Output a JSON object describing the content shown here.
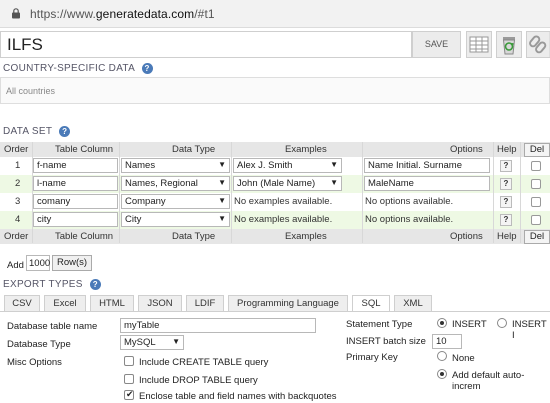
{
  "browser": {
    "url_prefix": "https://www.",
    "url_host": "generatedata.com",
    "url_suffix": "/#t1"
  },
  "header": {
    "title": "ILFS",
    "save_label": "SAVE"
  },
  "country": {
    "heading": "COUNTRY-SPECIFIC DATA",
    "value": "All countries"
  },
  "dataset": {
    "heading": "DATA SET",
    "columns": {
      "order": "Order",
      "table_column": "Table Column",
      "data_type": "Data Type",
      "examples": "Examples",
      "options": "Options",
      "help": "Help",
      "del": "Del"
    },
    "rows": [
      {
        "order": "1",
        "column": "f-name",
        "type": "Names",
        "example": "Alex J. Smith",
        "example_is_select": true,
        "option": "Name Initial. Surname",
        "option_is_input": true
      },
      {
        "order": "2",
        "column": "l-name",
        "type": "Names, Regional",
        "example": "John (Male Name)",
        "example_is_select": true,
        "option": "MaleName",
        "option_is_input": true
      },
      {
        "order": "3",
        "column": "comany",
        "type": "Company",
        "example": "No examples available.",
        "example_is_select": false,
        "option": "No options available.",
        "option_is_input": false
      },
      {
        "order": "4",
        "column": "city",
        "type": "City",
        "example": "No examples available.",
        "example_is_select": false,
        "option": "No options available.",
        "option_is_input": false
      }
    ],
    "help_glyph": "?",
    "add_label": "Add",
    "add_count": "1000",
    "add_button": "Row(s)"
  },
  "export": {
    "heading": "EXPORT TYPES",
    "tabs": [
      "CSV",
      "Excel",
      "HTML",
      "JSON",
      "LDIF",
      "Programming Language",
      "SQL",
      "XML"
    ],
    "active_tab": "SQL",
    "fields": {
      "table_name_label": "Database table name",
      "table_name_value": "myTable",
      "db_type_label": "Database Type",
      "db_type_value": "MySQL",
      "misc_label": "Misc Options",
      "misc_options": [
        {
          "label": "Include CREATE TABLE query",
          "checked": false
        },
        {
          "label": "Include DROP TABLE query",
          "checked": false
        },
        {
          "label": "Enclose table and field names with backquotes",
          "checked": true
        }
      ],
      "statement_type_label": "Statement Type",
      "statement_types": [
        {
          "label": "INSERT",
          "selected": true
        },
        {
          "label": "INSERT I",
          "selected": false
        }
      ],
      "batch_size_label": "INSERT batch size",
      "batch_size_value": "10",
      "primary_key_label": "Primary Key",
      "primary_key_options": [
        {
          "label": "None",
          "selected": false
        },
        {
          "label": "Add default auto-increm",
          "selected": true
        }
      ]
    }
  },
  "colors": {
    "help_blue": "#4a7ab8",
    "row_alt": "#eef9e4"
  }
}
